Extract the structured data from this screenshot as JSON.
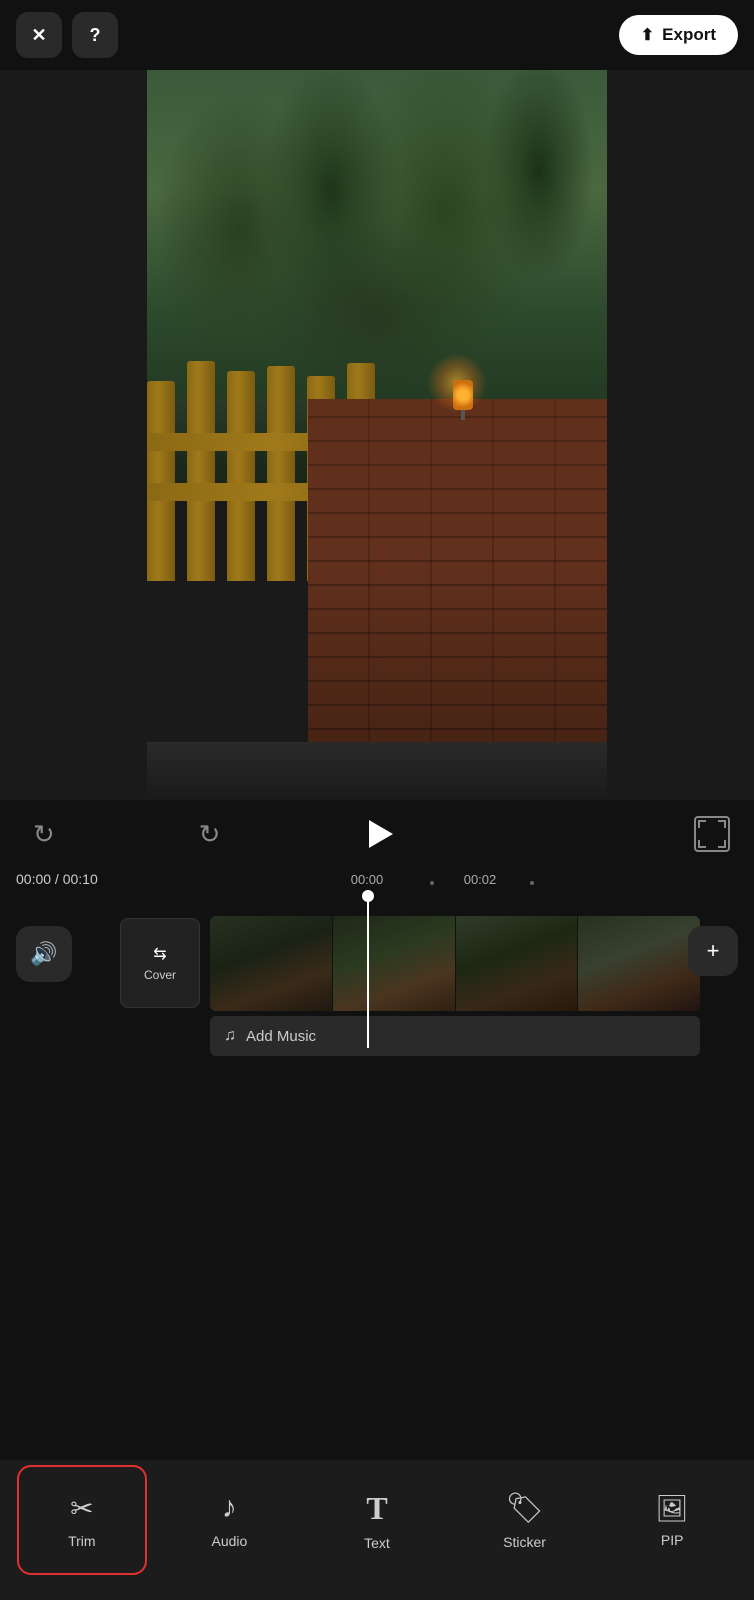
{
  "header": {
    "close_label": "✕",
    "help_label": "?",
    "export_label": "Export"
  },
  "controls": {
    "undo_label": "↺",
    "redo_label": "↻",
    "play_label": "▶",
    "time_current": "00:00",
    "time_total": "00:10",
    "timeline_mark1": "00:00",
    "timeline_mark2": "00:02"
  },
  "timeline": {
    "volume_icon": "🔊",
    "cover_icon": "⇆",
    "cover_label": "Cover",
    "add_music_label": "Add Music",
    "add_clip_icon": "+"
  },
  "toolbar": {
    "items": [
      {
        "id": "trim",
        "label": "Trim",
        "icon": "✂",
        "active": true
      },
      {
        "id": "audio",
        "label": "Audio",
        "icon": "♪",
        "active": false
      },
      {
        "id": "text",
        "label": "Text",
        "icon": "T",
        "active": false
      },
      {
        "id": "sticker",
        "label": "Sticker",
        "icon": "◉",
        "active": false
      },
      {
        "id": "pip",
        "label": "PIP",
        "icon": "⬜",
        "active": false
      }
    ]
  },
  "colors": {
    "background": "#111111",
    "active_border": "#e03030",
    "toolbar_bg": "#1c1c1c",
    "accent": "#ffffff"
  }
}
